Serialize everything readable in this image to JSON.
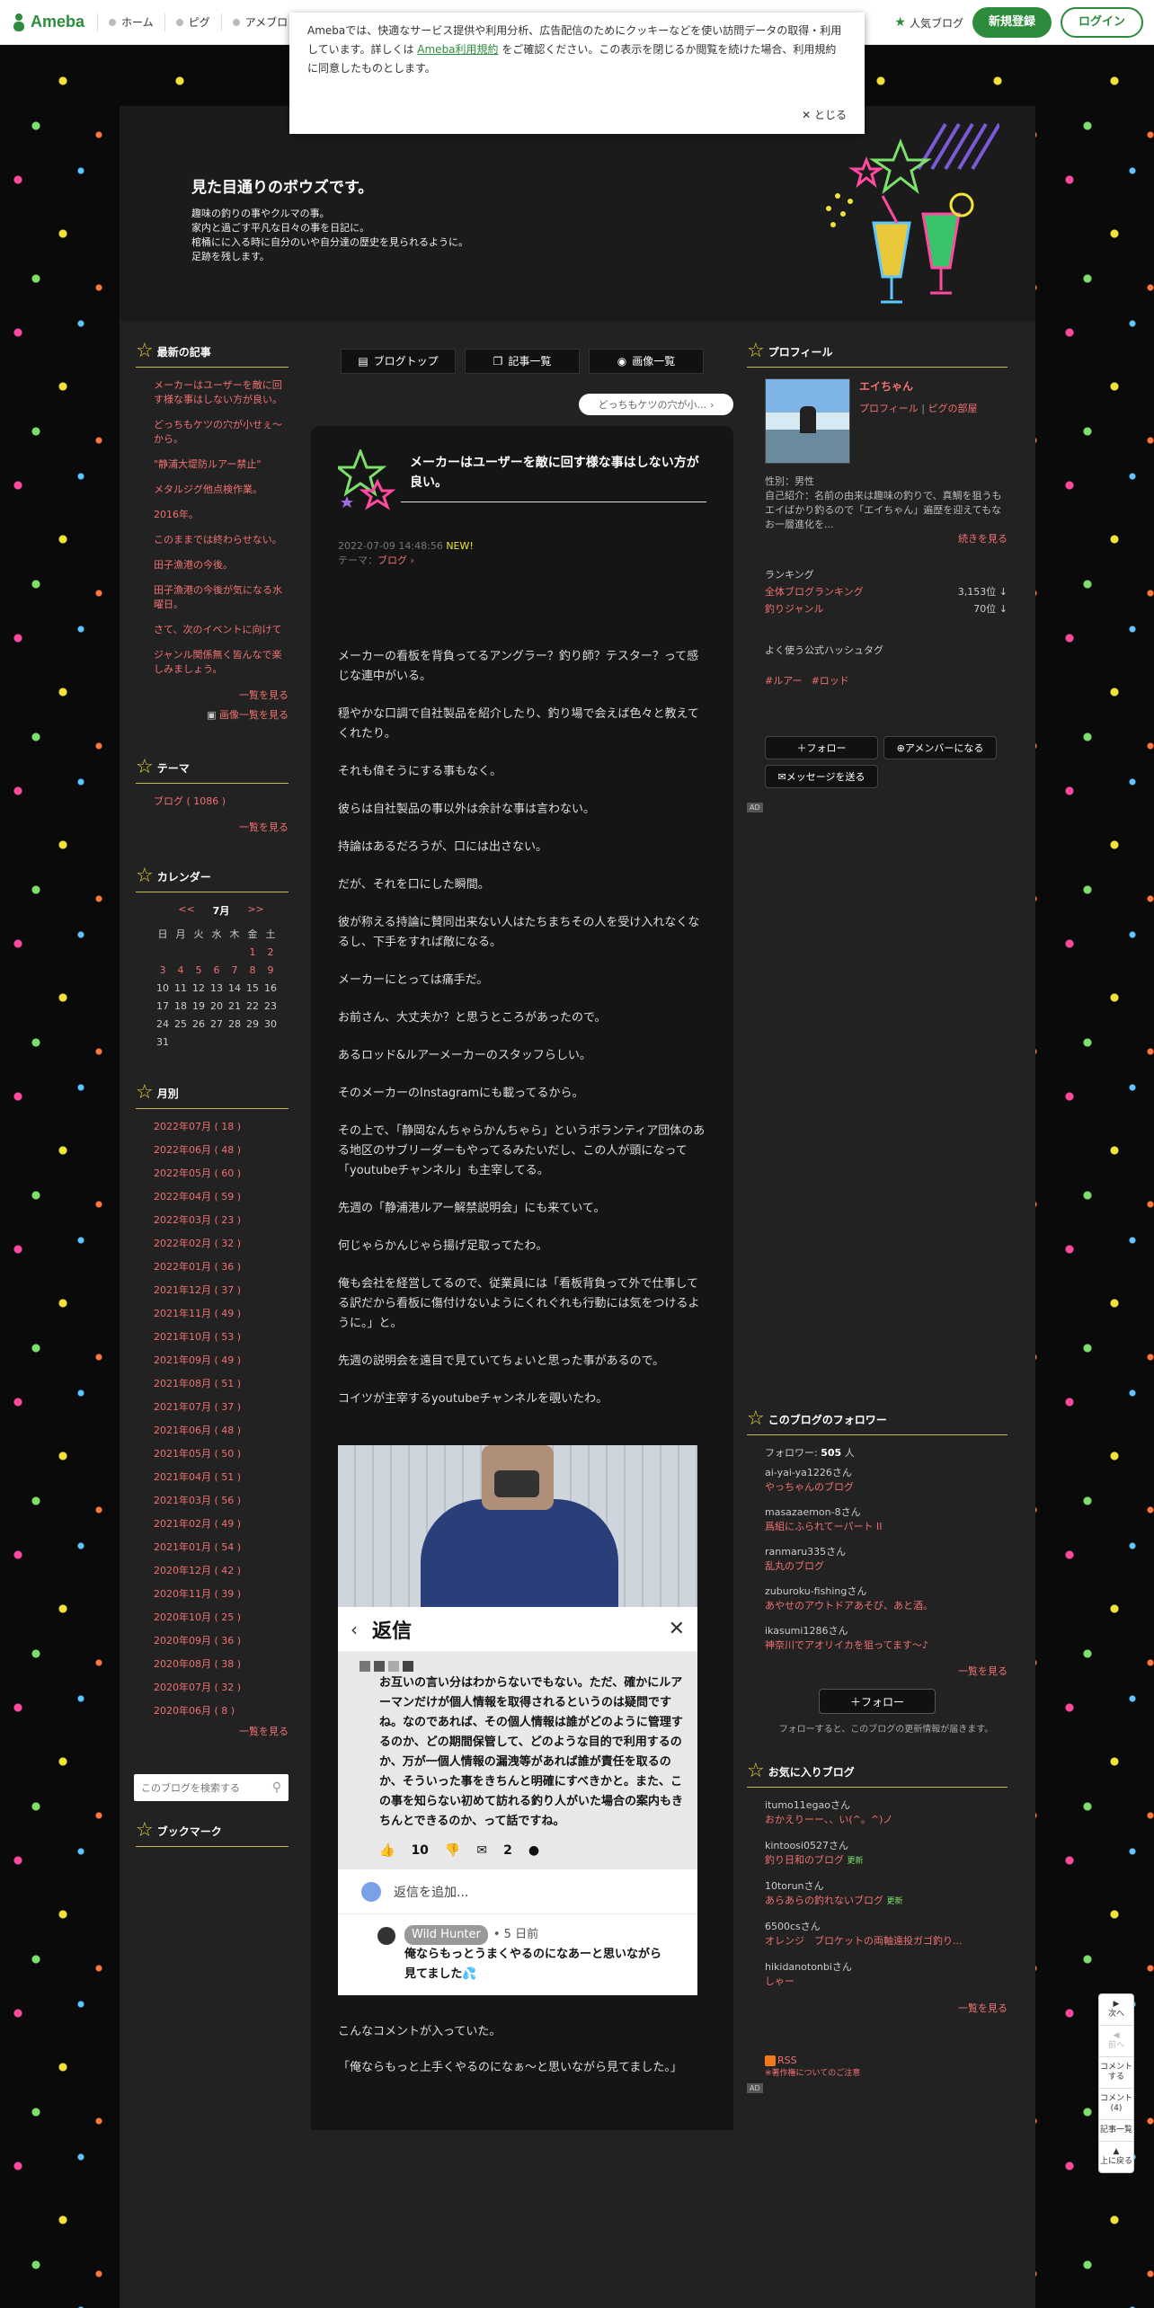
{
  "header": {
    "brand": "Ameba",
    "nav": [
      "ホーム",
      "ピグ",
      "アメブロ"
    ],
    "popular": "人気ブログ",
    "register": "新規登録",
    "login": "ログイン"
  },
  "cookie": {
    "text1": "Amebaでは、快適なサービス提供や利用分析、広告配信のためにクッキーなどを使い訪問データの取得・利用しています。詳しくは",
    "link": "Ameba利用規約",
    "text2": "をご確認ください。この表示を閉じるか閲覧を続けた場合、利用規約に同意したものとします。",
    "close": "とじる"
  },
  "blog": {
    "title": "見た目通りのボウズです。",
    "desc": [
      "趣味の釣りの事やクルマの事。",
      "家内と過ごす平凡な日々の事を日記に。",
      "棺桶にに入る時に自分のいや自分達の歴史を見られるように。",
      "足跡を残します。"
    ]
  },
  "left": {
    "recent_title": "最新の記事",
    "recent": [
      "メーカーはユーザーを敵に回す様な事はしない方が良い。",
      "どっちもケツの穴が小せぇ〜から。",
      "\"静浦大堤防ルアー禁止\"",
      "メタルジグ他点検作業。",
      "2016年。",
      "このままでは終わらせない。",
      "田子漁港の今後。",
      "田子漁港の今後が気になる水曜日。",
      "さて、次のイベントに向けて",
      "ジャンル関係無く皆んなで楽しみましょう。"
    ],
    "recent_more": "一覧を見る",
    "image_more": "画像一覧を見る",
    "theme_title": "テーマ",
    "theme_item": "ブログ ( 1086 )",
    "theme_more": "一覧を見る",
    "cal_title": "カレンダー",
    "cal_prev": "<<",
    "cal_month": "7月",
    "cal_next": ">>",
    "cal_days": [
      "日",
      "月",
      "火",
      "水",
      "木",
      "金",
      "土"
    ],
    "cal_rows": [
      [
        "",
        "",
        "",
        "",
        "",
        "1",
        "2"
      ],
      [
        "3",
        "4",
        "5",
        "6",
        "7",
        "8",
        "9"
      ],
      [
        "10",
        "11",
        "12",
        "13",
        "14",
        "15",
        "16"
      ],
      [
        "17",
        "18",
        "19",
        "20",
        "21",
        "22",
        "23"
      ],
      [
        "24",
        "25",
        "26",
        "27",
        "28",
        "29",
        "30"
      ],
      [
        "31",
        "",
        "",
        "",
        "",
        "",
        ""
      ]
    ],
    "cal_links": [
      "1",
      "2",
      "3",
      "4",
      "5",
      "6",
      "7",
      "8",
      "9"
    ],
    "month_title": "月別",
    "months": [
      "2022年07月 ( 18 )",
      "2022年06月 ( 48 )",
      "2022年05月 ( 60 )",
      "2022年04月 ( 59 )",
      "2022年03月 ( 23 )",
      "2022年02月 ( 32 )",
      "2022年01月 ( 36 )",
      "2021年12月 ( 37 )",
      "2021年11月 ( 49 )",
      "2021年10月 ( 53 )",
      "2021年09月 ( 49 )",
      "2021年08月 ( 51 )",
      "2021年07月 ( 37 )",
      "2021年06月 ( 48 )",
      "2021年05月 ( 50 )",
      "2021年04月 ( 51 )",
      "2021年03月 ( 56 )",
      "2021年02月 ( 49 )",
      "2021年01月 ( 54 )",
      "2020年12月 ( 42 )",
      "2020年11月 ( 39 )",
      "2020年10月 ( 25 )",
      "2020年09月 ( 36 )",
      "2020年08月 ( 38 )",
      "2020年07月 ( 32 )",
      "2020年06月 ( 8 )"
    ],
    "month_more": "一覧を見る",
    "search_placeholder": "このブログを検索する",
    "bookmark_title": "ブックマーク"
  },
  "center": {
    "tabs": [
      "ブログトップ",
      "記事一覧",
      "画像一覧"
    ],
    "prev": "どっちもケツの穴が小...",
    "title": "メーカーはユーザーを敵に回す様な事はしない方が良い。",
    "date": "2022-07-09 14:48:56",
    "new": "NEW!",
    "theme_label": "テーマ：",
    "theme": "ブログ",
    "paragraphs": [
      "メーカーの看板を背負ってるアングラー？釣り師？テスター？って感じな連中がいる。",
      "穏やかな口調で自社製品を紹介したり、釣り場で会えば色々と教えてくれたり。",
      "それも偉そうにする事もなく。",
      "彼らは自社製品の事以外は余計な事は言わない。",
      "持論はあるだろうが、口には出さない。",
      "だが、それを口にした瞬間。",
      "彼が称える持論に賛同出来ない人はたちまちその人を受け入れなくなるし、下手をすれば敵になる。",
      "メーカーにとっては痛手だ。",
      "お前さん、大丈夫か？と思うところがあったので。",
      "あるロッド&ルアーメーカーのスタッフらしい。",
      "そのメーカーのInstagramにも載ってるから。",
      "その上で、「静岡なんちゃらかんちゃら」というボランティア団体のある地区のサブリーダーもやってるみたいだし、この人が頭になって「youtubeチャンネル」も主宰してる。",
      "先週の「静浦港ルアー解禁説明会」にも来ていて。",
      "何じゃらかんじゃら揚げ足取ってたわ。",
      "俺も会社を経営してるので、従業員には「看板背負って外で仕事してる訳だから看板に傷付けないようにくれぐれも行動には気をつけるように。」と。",
      "先週の説明会を遠目で見ていてちょいと思った事があるので。",
      "コイツが主宰するyoutubeチャンネルを覗いたわ。"
    ],
    "reply": {
      "title": "返信",
      "body": "お互いの言い分はわからないでもない。ただ、確かにルアーマンだけが個人情報を取得されるというのは疑問ですね。なのであれば、その個人情報は誰がどのように管理するのか、どの期間保管して、どのような目的で利用するのか、万が一個人情報の漏洩等があれば誰が責任を取るのか、そういった事をきちんと明確にすべきかと。また、この事を知らない初めて訪れる釣り人がいた場合の案内もきちんとできるのか、って話ですね。",
      "likes": "10",
      "comments": "2",
      "add": "返信を追加...",
      "sub_name": "Wild Hunter",
      "sub_time": "• 5 日前",
      "sub_msg": "俺ならもっとうまくやるのになあーと思いながら見てました💦"
    },
    "after": [
      "こんなコメントが入っていた。",
      "「俺ならもっと上手くやるのになぁ〜と思いながら見てました。」"
    ]
  },
  "right": {
    "profile_title": "プロフィール",
    "name": "エイちゃん",
    "profile_link": "プロフィール",
    "pig_link": "ピグの部屋",
    "gender": "性別：男性",
    "intro": "自己紹介：名前の由来は趣味の釣りで、真鯛を狙うもエイばかり釣るので「エイちゃん」遍歴を迎えてもなお一層進化を...",
    "intro_more": "続きを見る",
    "rank_label": "ランキング",
    "rank1_k": "全体ブログランキング",
    "rank1_v": "3,153位 ↓",
    "rank2_k": "釣りジャンル",
    "rank2_v": "70位 ↓",
    "hashtag_label": "よく使う公式ハッシュタグ",
    "tags": [
      "#ルアー",
      "#ロッド"
    ],
    "follow": "フォロー",
    "member": "アメンバーになる",
    "message": "メッセージを送る",
    "ad": "AD",
    "followers_title": "このブログのフォロワー",
    "follower_count_label": "フォロワー:",
    "follower_count": "505",
    "follower_unit": "人",
    "followers": [
      {
        "user": "ai-yai-ya1226さん",
        "blog": "やっちゃんのブログ"
      },
      {
        "user": "masazaemon-8さん",
        "blog": "爲組にふられてーパート II"
      },
      {
        "user": "ranmaru335さん",
        "blog": "乱丸のブログ"
      },
      {
        "user": "zuburoku-fishingさん",
        "blog": "あやせのアウトドアあそび、あと酒。"
      },
      {
        "user": "ikasumi1286さん",
        "blog": "神奈川でアオリイカを狙ってます〜♪"
      }
    ],
    "followers_more": "一覧を見る",
    "follow_big": "フォロー",
    "follow_note": "フォローすると、このブログの更新情報が届きます。",
    "fav_title": "お気に入りブログ",
    "favs": [
      {
        "user": "itumo11egaoさん",
        "blog": "おかえりーー、、い(^。^)ノ",
        "upd": ""
      },
      {
        "user": "kintoosi0527さん",
        "blog": "釣り日和のブログ",
        "upd": "更新"
      },
      {
        "user": "10torunさん",
        "blog": "あらあらの釣れないブログ",
        "upd": "更新"
      },
      {
        "user": "6500csさん",
        "blog": "オレンジ　ブロケットの両軸遠投ガゴ釣り...",
        "upd": ""
      },
      {
        "user": "hikidanotonbiさん",
        "blog": "しゃー",
        "upd": ""
      }
    ],
    "fav_more": "一覧を見る",
    "rss": "RSS",
    "rss_note": "※著作権についてのご注意"
  },
  "float": {
    "next": "次へ",
    "prev": "前へ",
    "comment": "コメントする",
    "comment_count": "コメント(4)",
    "list": "記事一覧",
    "top": "上に戻る"
  }
}
